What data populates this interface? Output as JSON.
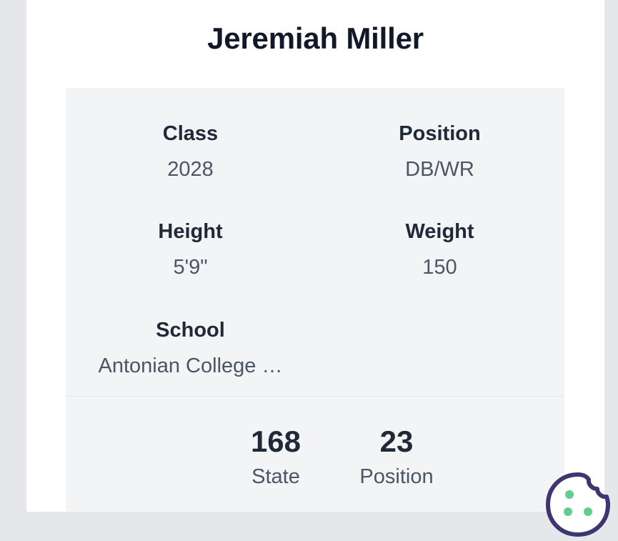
{
  "player": {
    "name": "Jeremiah Miller"
  },
  "info": {
    "class": {
      "label": "Class",
      "value": "2028"
    },
    "position": {
      "label": "Position",
      "value": "DB/WR"
    },
    "height": {
      "label": "Height",
      "value": "5'9\""
    },
    "weight": {
      "label": "Weight",
      "value": "150"
    },
    "school": {
      "label": "School",
      "value": "Antonian College …"
    }
  },
  "rankings": {
    "state": {
      "value": "168",
      "label": "State"
    },
    "position": {
      "value": "23",
      "label": "Position"
    }
  },
  "cookie_widget": {
    "icon": "cookie-icon",
    "stroke_color": "#3c3671",
    "dot_color": "#5fcf8f"
  }
}
